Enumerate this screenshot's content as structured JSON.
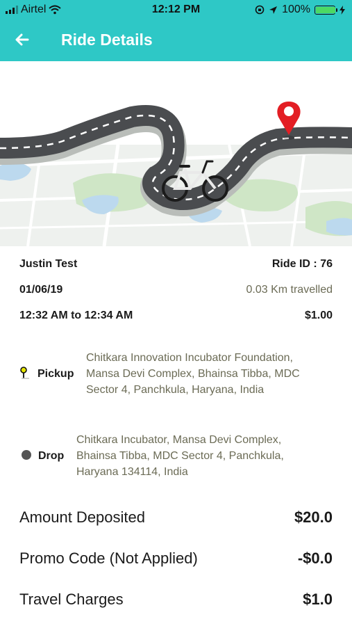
{
  "status_bar": {
    "carrier": "Airtel",
    "time": "12:12 PM",
    "battery": "100%"
  },
  "header": {
    "title": "Ride Details",
    "back_icon": "back-arrow-icon"
  },
  "hero": {
    "illustration": "winding road with bicycle and location pin",
    "pin_color": "#e31e24"
  },
  "ride": {
    "user_name": "Justin Test",
    "ride_id": "Ride ID : 76",
    "date": "01/06/19",
    "distance": "0.03 Km travelled",
    "time_range": "12:32 AM to 12:34 AM",
    "cost": "$1.00"
  },
  "pickup": {
    "label": "Pickup",
    "lines": [
      "Chitkara Innovation Incubator Foundation,",
      "Mansa Devi Complex, Bhainsa Tibba, MDC",
      "Sector 4, Panchkula, Haryana, India"
    ]
  },
  "drop": {
    "label": "Drop",
    "lines": [
      "Chitkara Incubator, Mansa Devi Complex,",
      "Bhainsa Tibba, MDC Sector 4, Panchkula,",
      "Haryana 134114, India"
    ]
  },
  "charges": {
    "deposit": {
      "label": "Amount Deposited",
      "value": "$20.0"
    },
    "promo": {
      "label": "Promo Code (Not Applied)",
      "value": "-$0.0"
    },
    "travel": {
      "label": "Travel Charges",
      "value": "$1.0"
    }
  },
  "colors": {
    "accent": "#2ec8c6",
    "muted_text": "#6b6b55"
  }
}
